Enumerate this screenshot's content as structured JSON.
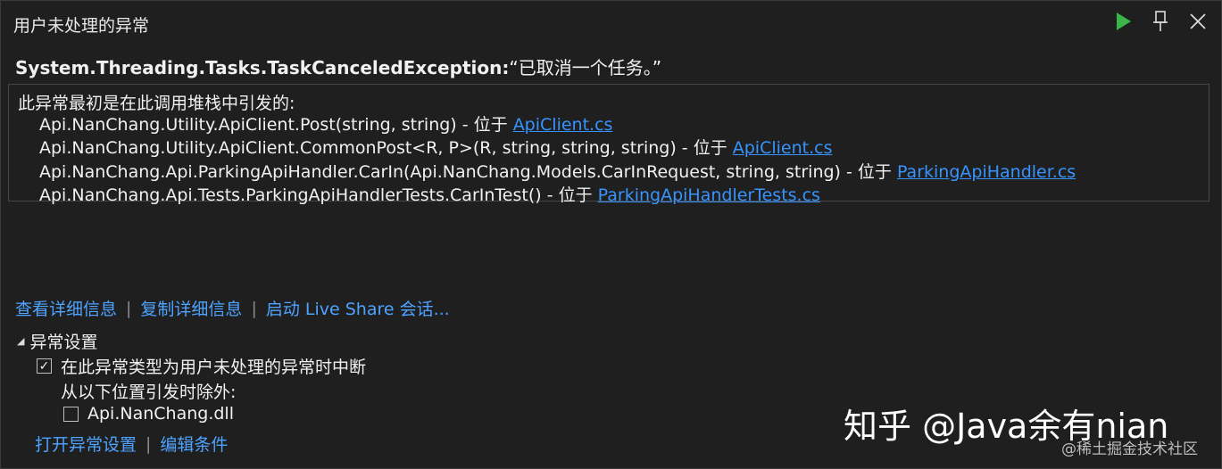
{
  "window": {
    "title": "用户未处理的异常",
    "icons": [
      "play-icon",
      "pin-icon",
      "close-icon"
    ]
  },
  "exception": {
    "type": "System.Threading.Tasks.TaskCanceledException:",
    "message": "“已取消一个任务。”"
  },
  "stack": {
    "header": "此异常最初是在此调用堆栈中引发的:",
    "frames": [
      {
        "text": "Api.NanChang.Utility.ApiClient.Post(string, string) - 位于 ",
        "file": "ApiClient.cs"
      },
      {
        "text": "Api.NanChang.Utility.ApiClient.CommonPost<R, P>(R, string, string, string) - 位于 ",
        "file": "ApiClient.cs"
      },
      {
        "text": "Api.NanChang.Api.ParkingApiHandler.CarIn(Api.NanChang.Models.CarInRequest, string, string) - 位于 ",
        "file": "ParkingApiHandler.cs"
      },
      {
        "text": "Api.NanChang.Api.Tests.ParkingApiHandlerTests.CarInTest() - 位于 ",
        "file": "ParkingApiHandlerTests.cs"
      }
    ]
  },
  "links": {
    "view_details": "查看详细信息",
    "copy_details": "复制详细信息",
    "live_share": "启动 Live Share 会话...",
    "separator": "|"
  },
  "settings": {
    "header": "异常设置",
    "break_label": "在此异常类型为用户未处理的异常时中断",
    "break_checked": true,
    "except_label": "从以下位置引发时除外:",
    "module_label": "Api.NanChang.dll",
    "module_checked": false,
    "open_settings": "打开异常设置",
    "edit_conditions": "编辑条件"
  },
  "watermark": {
    "main": "知乎 @Java余有nian",
    "sub": "@稀土掘金技术社区"
  },
  "colors": {
    "background": "#1f1f1f",
    "link": "#3794ff",
    "play_green": "#3bb54a"
  }
}
